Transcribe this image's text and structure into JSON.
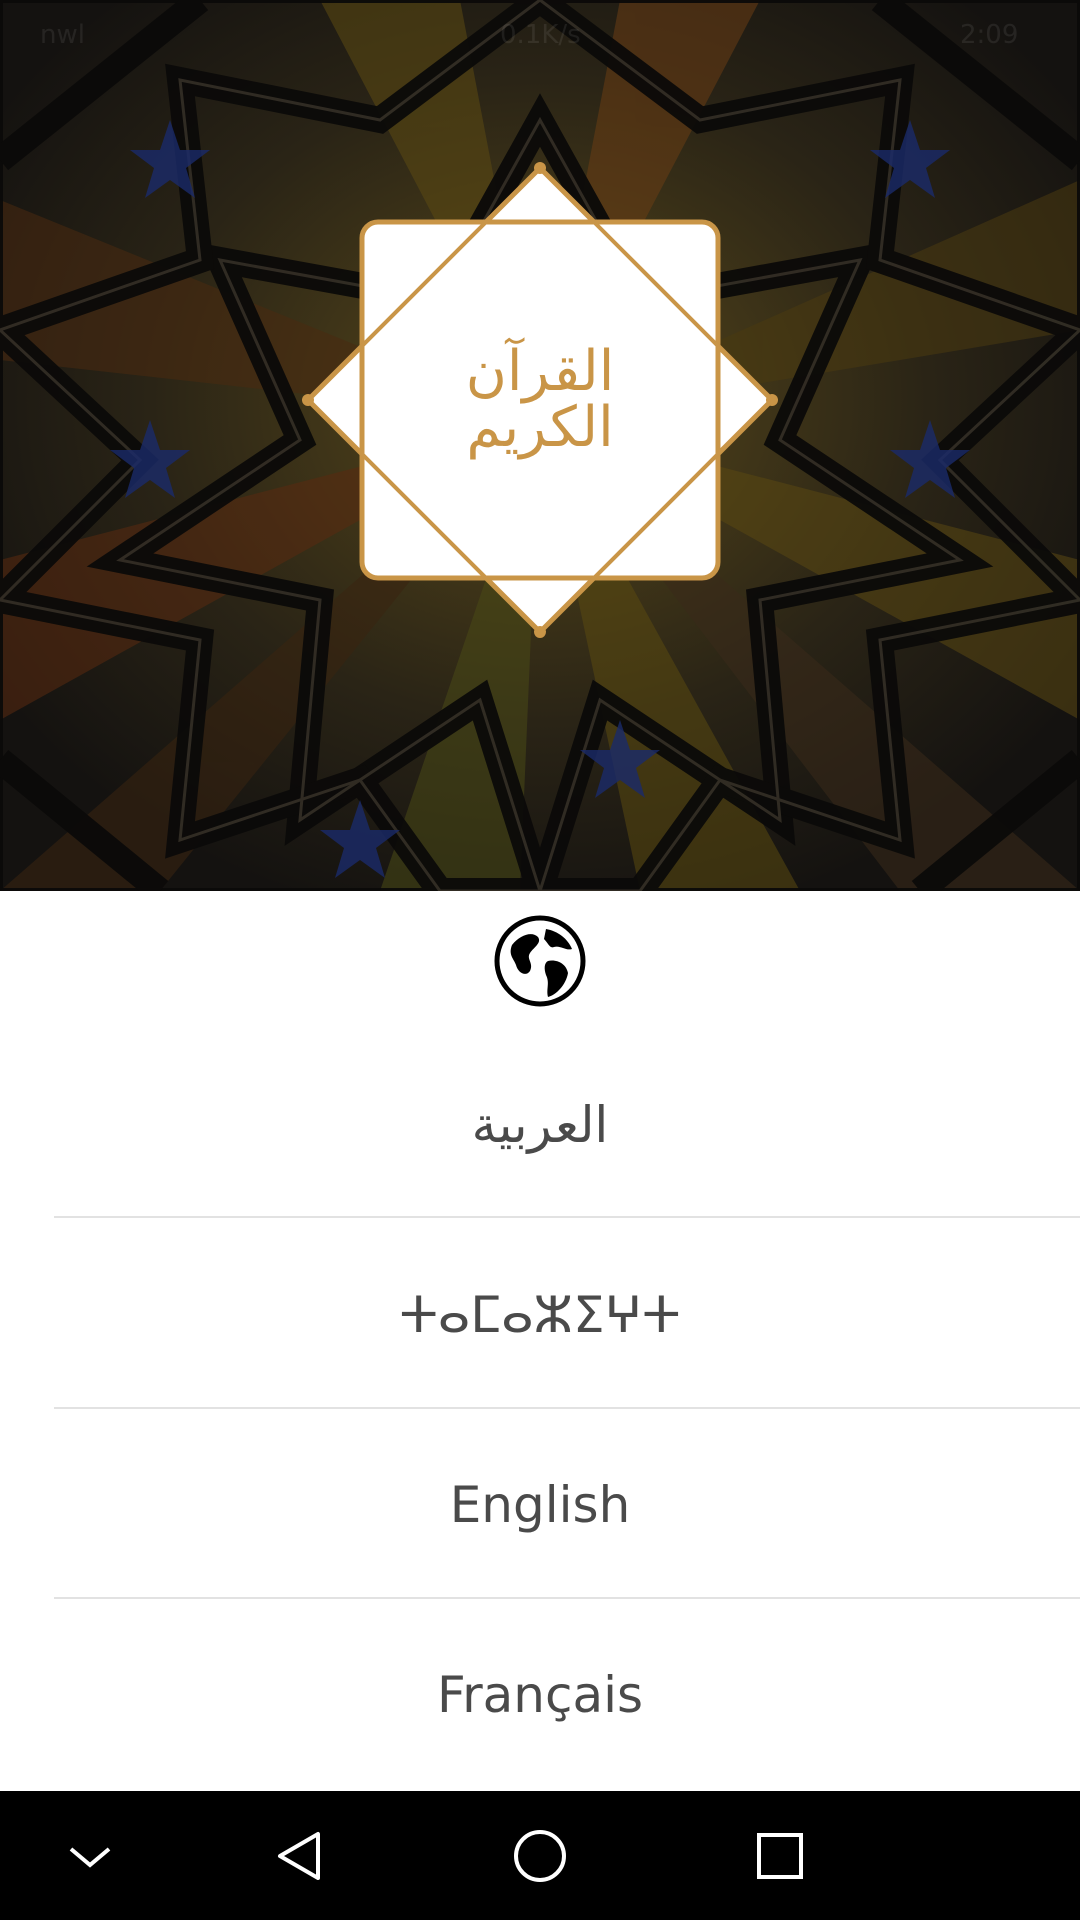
{
  "status_bar": {
    "left_text": "nwl",
    "center_text": "0.1K/s",
    "right_text": "2:09"
  },
  "header": {
    "logo_text": "القرآن الكريم",
    "accent_color": "#c99547"
  },
  "language_selector": {
    "icon": "globe-icon",
    "items": [
      {
        "label": "العربية"
      },
      {
        "label": "ⵜⴰⵎⴰⵣⵉⵖⵜ"
      },
      {
        "label": "English"
      },
      {
        "label": "Français"
      }
    ]
  },
  "navbar": {
    "buttons": [
      "chevron-down-icon",
      "back-icon",
      "home-icon",
      "recents-icon"
    ]
  }
}
